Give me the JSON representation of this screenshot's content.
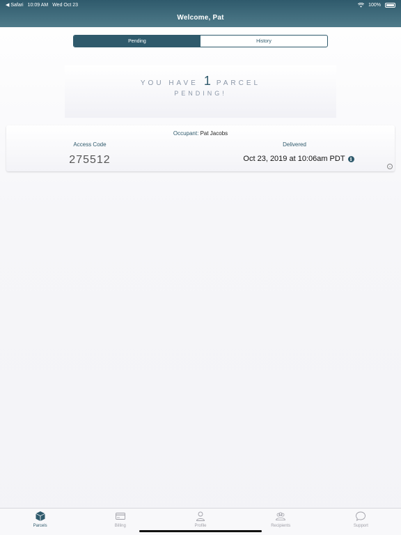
{
  "status_bar": {
    "back_app": "◀ Safari",
    "time": "10:09 AM",
    "date": "Wed Oct 23",
    "battery": "100%"
  },
  "header": {
    "title": "Welcome, Pat"
  },
  "segments": {
    "pending": "Pending",
    "history": "History",
    "selected": "Pending"
  },
  "banner": {
    "prefix": "YOU HAVE",
    "count": "1",
    "suffix": "PARCEL",
    "line2": "PENDING!"
  },
  "parcel": {
    "occupant_label": "Occupant:",
    "occupant_name": "Pat Jacobs",
    "access_code_label": "Access Code",
    "access_code": "275512",
    "delivered_label": "Delivered",
    "delivered_value": "Oct 23, 2019 at 10:06am PDT"
  },
  "tabbar": {
    "tabs": [
      {
        "label": "Parcels",
        "icon": "box-icon",
        "active": true
      },
      {
        "label": "Billing",
        "icon": "card-icon",
        "active": false
      },
      {
        "label": "Profile",
        "icon": "person-icon",
        "active": false
      },
      {
        "label": "Recipients",
        "icon": "group-icon",
        "active": false
      },
      {
        "label": "Support",
        "icon": "chat-bubble-icon",
        "active": false
      }
    ]
  },
  "colors": {
    "accent": "#2f5a6c",
    "inactive": "#a0a0a8"
  }
}
